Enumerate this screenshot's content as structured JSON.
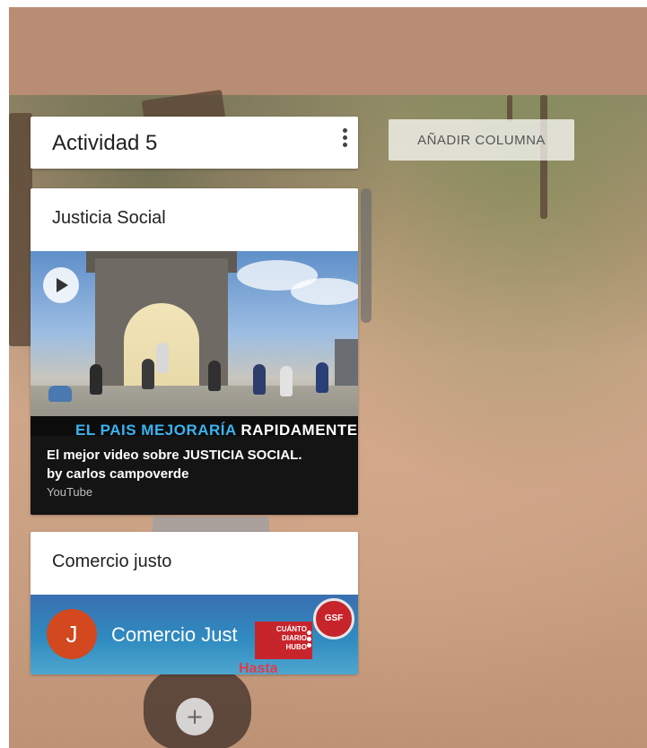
{
  "board": {
    "column_title": "Actividad 5",
    "add_column_label": "AÑADIR COLUMNA",
    "add_card_label": "+",
    "column_menu_icon": "more-vert-icon"
  },
  "cards": [
    {
      "title": "Justicia Social",
      "video": {
        "thumbnail_caption_blue": "EL PAIS MEJORARÍA",
        "thumbnail_caption_white": " RAPIDAMENTE",
        "title": "El mejor video sobre JUSTICIA SOCIAL.",
        "author": "by carlos campoverde",
        "source": "YouTube",
        "play_icon": "play-icon"
      }
    },
    {
      "title": "Comercio justo",
      "video": {
        "avatar_initial": "J",
        "title": "Comercio Just",
        "sign_text_1": "CUÁNTO",
        "sign_text_2": "DIARIO",
        "sign_text_3": "HUBO",
        "logo_text": "GSF",
        "bottom_text": "Hasta"
      }
    }
  ],
  "colors": {
    "header_band": "#b88d74",
    "video_info_bg": "#141414",
    "avatar_bg": "#d3481e",
    "accent_red": "#c8242c"
  }
}
